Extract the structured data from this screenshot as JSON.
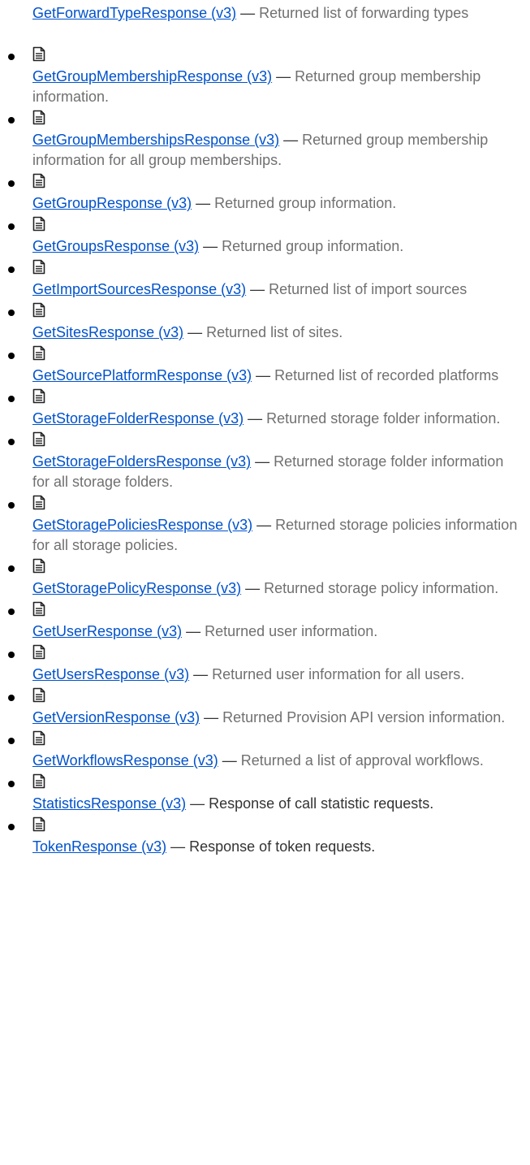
{
  "colors": {
    "link": "#0052cc",
    "text": "#707070",
    "bullet": "#000000"
  },
  "intro": {
    "link": "GetForwardTypeResponse (v3)",
    "separator": "—",
    "description": "Returned list of forwarding types"
  },
  "items": [
    {
      "icon": "document-icon",
      "link": "GetGroupMembershipResponse (v3)",
      "separator": "—",
      "description": "Returned group membership information."
    },
    {
      "icon": "document-icon",
      "link": "GetGroupMembershipsResponse (v3)",
      "separator": "—",
      "description": "Returned group membership information for all group memberships."
    },
    {
      "icon": "document-icon",
      "link": "GetGroupResponse (v3)",
      "separator": "—",
      "description": "Returned group information."
    },
    {
      "icon": "document-icon",
      "link": "GetGroupsResponse (v3)",
      "separator": "—",
      "description": "Returned group information."
    },
    {
      "icon": "document-icon",
      "link": "GetImportSourcesResponse (v3)",
      "separator": "—",
      "description": "Returned list of import sources"
    },
    {
      "icon": "document-icon",
      "link": "GetSitesResponse (v3)",
      "separator": "—",
      "description": "Returned list of sites."
    },
    {
      "icon": "document-icon",
      "link": "GetSourcePlatformResponse (v3)",
      "separator": "—",
      "description": "Returned list of recorded platforms"
    },
    {
      "icon": "document-icon",
      "link": "GetStorageFolderResponse (v3)",
      "separator": "—",
      "description": "Returned storage folder information."
    },
    {
      "icon": "document-icon",
      "link": "GetStorageFoldersResponse (v3)",
      "separator": "—",
      "description": "Returned storage folder information for all storage folders."
    },
    {
      "icon": "document-icon",
      "link": "GetStoragePoliciesResponse (v3)",
      "separator": "—",
      "description": "Returned storage policies information for all storage policies."
    },
    {
      "icon": "document-icon",
      "link": "GetStoragePolicyResponse (v3)",
      "separator": "—",
      "description": "Returned storage policy information."
    },
    {
      "icon": "document-icon",
      "link": "GetUserResponse (v3)",
      "separator": "—",
      "description": "Returned user information."
    },
    {
      "icon": "document-icon",
      "link": "GetUsersResponse (v3)",
      "separator": "—",
      "description": "Returned user information for all users."
    },
    {
      "icon": "document-icon",
      "link": "GetVersionResponse (v3)",
      "separator": "—",
      "description": "Returned Provision API version information."
    },
    {
      "icon": "document-icon",
      "link": "GetWorkflowsResponse (v3)",
      "separator": "—",
      "description": "Returned a list of approval workflows."
    },
    {
      "icon": "document-icon",
      "link": "StatisticsResponse (v3)",
      "separator": "—",
      "description": "Response of call statistic requests."
    },
    {
      "icon": "document-icon",
      "link": "TokenResponse (v3)",
      "separator": "—",
      "description": "Response of token requests."
    }
  ]
}
